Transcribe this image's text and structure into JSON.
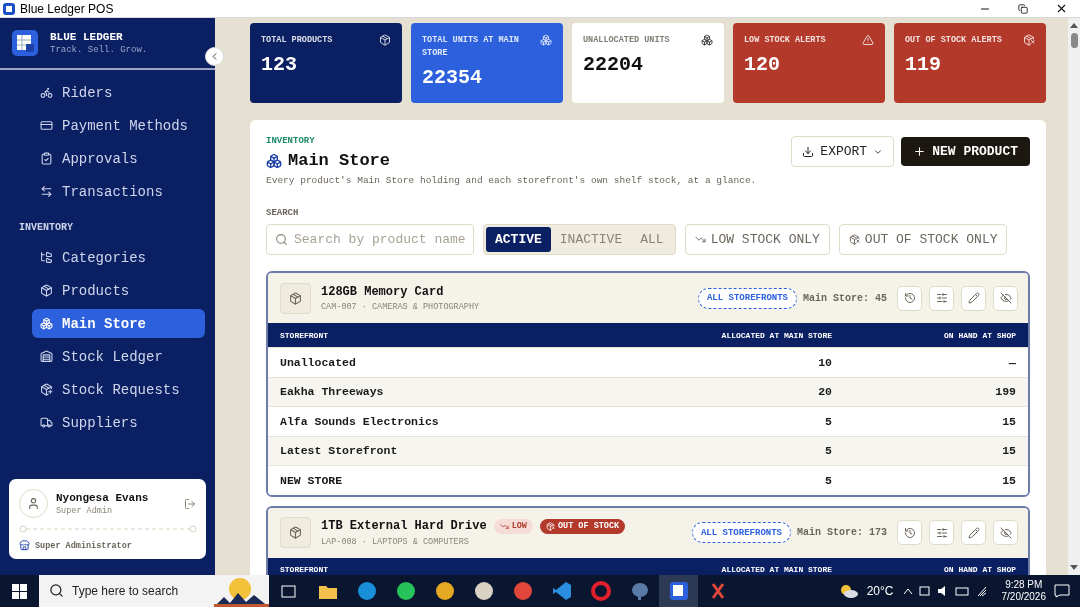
{
  "window": {
    "title": "Blue Ledger POS"
  },
  "sidebar": {
    "brand": "BLUE LEDGER",
    "tagline": "Track. Sell. Grow.",
    "nav": [
      {
        "kind": "item",
        "label": "Riders",
        "selected": false
      },
      {
        "kind": "item",
        "label": "Payment Methods",
        "selected": false
      },
      {
        "kind": "item",
        "label": "Approvals",
        "selected": false
      },
      {
        "kind": "item",
        "label": "Transactions",
        "selected": false
      },
      {
        "kind": "section",
        "label": "INVENTORY"
      },
      {
        "kind": "item",
        "label": "Categories",
        "selected": false
      },
      {
        "kind": "item",
        "label": "Products",
        "selected": false
      },
      {
        "kind": "item",
        "label": "Main Store",
        "selected": true
      },
      {
        "kind": "item",
        "label": "Stock Ledger",
        "selected": false
      },
      {
        "kind": "item",
        "label": "Stock Requests",
        "selected": false
      },
      {
        "kind": "item",
        "label": "Suppliers",
        "selected": false
      }
    ],
    "user": {
      "name": "Nyongesa Evans",
      "role": "Super Admin",
      "scope": "Super Administrator"
    }
  },
  "stats": [
    {
      "label": "TOTAL PRODUCTS",
      "value": "123",
      "color": "#0b1f63"
    },
    {
      "label": "TOTAL UNITS AT MAIN STORE",
      "value": "22354",
      "color": "#2c60dc"
    },
    {
      "label": "UNALLOCATED UNITS",
      "value": "22204",
      "color": "#ffffff"
    },
    {
      "label": "LOW STOCK ALERTS",
      "value": "120",
      "color": "#b3392a"
    },
    {
      "label": "OUT OF STOCK ALERTS",
      "value": "119",
      "color": "#b3392a"
    }
  ],
  "panel": {
    "eyebrow": "INVENTORY",
    "title": "Main Store",
    "description": "Every product's Main Store holding and each storefront's own shelf stock, at a glance.",
    "export": "EXPORT",
    "new_product": "NEW PRODUCT",
    "search_label": "SEARCH",
    "search": {
      "placeholder": "Search by product name"
    },
    "status_filter": [
      {
        "label": "ACTIVE",
        "selected": true
      },
      {
        "label": "INACTIVE",
        "selected": false
      },
      {
        "label": "ALL",
        "selected": false
      }
    ],
    "toggles": [
      {
        "label": "LOW STOCK ONLY",
        "selected": false
      },
      {
        "label": "OUT OF STOCK ONLY",
        "selected": false
      }
    ]
  },
  "products": [
    {
      "name": "128GB Memory Card",
      "meta": "CAM-007 · CAMERAS & PHOTOGRAPHY",
      "scope": "ALL STOREFRONTS",
      "main_store": "Main Store: 45",
      "columns": [
        "STOREFRONT",
        "ALLOCATED AT MAIN STORE",
        "ON HAND AT SHOP"
      ],
      "rows": [
        {
          "cells": [
            "Unallocated",
            "10",
            "—"
          ]
        },
        {
          "cells": [
            "Eakha Threeways",
            "20",
            "199"
          ]
        },
        {
          "cells": [
            "Alfa Sounds Electronics",
            "5",
            "15"
          ]
        },
        {
          "cells": [
            "Latest Storefront",
            "5",
            "15"
          ]
        },
        {
          "cells": [
            "NEW STORE",
            "5",
            "15"
          ]
        }
      ]
    },
    {
      "name": "1TB External Hard Drive",
      "meta": "LAP-008 · LAPTOPS & COMPUTERS",
      "badges": [
        {
          "kind": "low",
          "label": "LOW"
        },
        {
          "kind": "out",
          "label": "OUT OF STOCK"
        }
      ],
      "scope": "ALL STOREFRONTS",
      "main_store": "Main Store: 173",
      "columns": [
        "STOREFRONT",
        "ALLOCATED AT MAIN STORE",
        "ON HAND AT SHOP"
      ]
    }
  ],
  "taskbar": {
    "search": {
      "placeholder": "Type here to search"
    },
    "temperature": "20°C",
    "time": "9:28 PM",
    "date": "7/20/2026"
  }
}
